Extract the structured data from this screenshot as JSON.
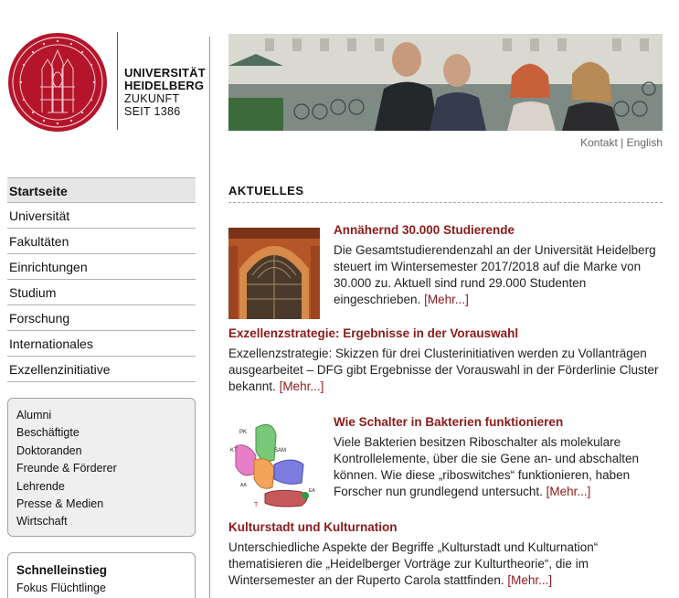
{
  "logo": {
    "line1": "UNIVERSITÄT",
    "line2": "HEIDELBERG",
    "line3": "ZUKUNFT",
    "line4": "SEIT 1386",
    "seal_color": "#b5152b"
  },
  "mainnav": {
    "items": [
      {
        "label": "Startseite"
      },
      {
        "label": "Universität"
      },
      {
        "label": "Fakultäten"
      },
      {
        "label": "Einrichtungen"
      },
      {
        "label": "Studium"
      },
      {
        "label": "Forschung"
      },
      {
        "label": "Internationales"
      },
      {
        "label": "Exzellenzinitiative"
      }
    ]
  },
  "subnav": {
    "items": [
      {
        "label": "Alumni"
      },
      {
        "label": "Beschäftigte"
      },
      {
        "label": "Doktoranden"
      },
      {
        "label": "Freunde & Förderer"
      },
      {
        "label": "Lehrende"
      },
      {
        "label": "Presse & Medien"
      },
      {
        "label": "Wirtschaft"
      }
    ]
  },
  "quick": {
    "title": "Schnelleinstieg",
    "items": [
      {
        "label": "Fokus Flüchtlinge"
      }
    ]
  },
  "toplinks": {
    "kontakt": "Kontakt",
    "sep": "|",
    "english": "English"
  },
  "section": {
    "title": "AKTUELLES"
  },
  "news": [
    {
      "title": "Annähernd 30.000 Studierende",
      "body": "Die Gesamtstudierendenzahl an der Universität Heidelberg steuert im Wintersemester 2017/2018 auf die Marke von 30.000 zu. Aktuell sind rund 29.000 Studenten eingeschrieben.",
      "more": "[Mehr...]"
    },
    {
      "title": "Exzellenzstrategie: Ergebnisse in der Vorauswahl",
      "body": "Exzellenzstrategie: Skizzen für drei Clusterinitiativen werden zu Vollanträgen ausgearbeitet – DFG gibt Ergebnisse der Vorauswahl in der Förderlinie Cluster bekannt.",
      "more": "[Mehr...]"
    },
    {
      "title": "Wie Schalter in Bakterien funktionieren",
      "body": "Viele Bakterien besitzen Riboschalter als molekulare Kontrollelemente, über die sie Gene an- und abschalten können. Wie diese „riboswitches“ funktionieren, haben Forscher nun grundlegend untersucht.",
      "more": "[Mehr...]"
    },
    {
      "title": "Kulturstadt und Kulturnation",
      "body": "Unterschiedliche Aspekte der Begriffe „Kulturstadt und Kulturnation“ thematisieren die „Heidelberger Vorträge zur Kulturtheorie“, die im Wintersemester an der Ruperto Carola stattfinden.",
      "more": "[Mehr...]"
    }
  ],
  "diagram": {
    "pk": "PK",
    "kt": "KT",
    "sam": "SAM",
    "aa": "AA",
    "ea": "EA",
    "t": "T"
  },
  "colors": {
    "accent": "#8b1a1a",
    "seal": "#b5152b"
  }
}
